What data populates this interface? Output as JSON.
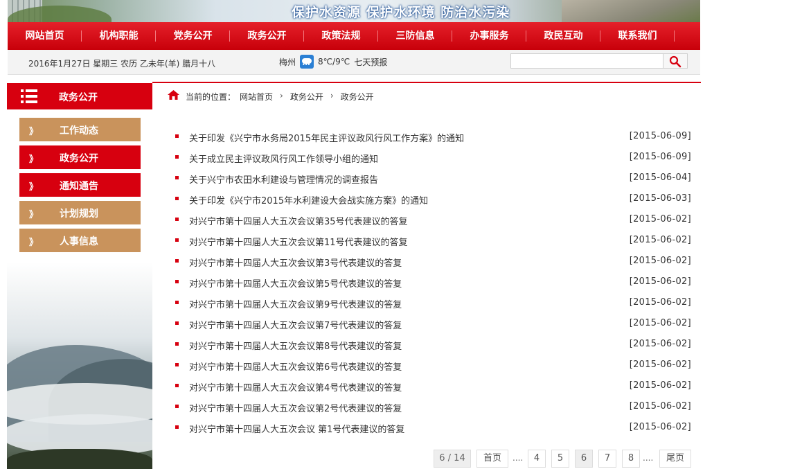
{
  "banner": {
    "slogan": "保护水资源  保护水环境  防治水污染"
  },
  "nav": [
    "网站首页",
    "机构职能",
    "党务公开",
    "政务公开",
    "政策法规",
    "三防信息",
    "办事服务",
    "政民互动",
    "联系我们"
  ],
  "infobar": {
    "date": "2016年1月27日  星期三  农历 乙未年(羊) 腊月十八",
    "city": "梅州",
    "temp": "8℃/9℃",
    "forecast": "七天预报",
    "search_placeholder": ""
  },
  "sidebar": {
    "title": "政务公开",
    "chev": "》",
    "items": [
      {
        "label": "工作动态",
        "color": "#c9935c"
      },
      {
        "label": "政务公开",
        "color": "#d7000f"
      },
      {
        "label": "通知通告",
        "color": "#d7000f"
      },
      {
        "label": "计划规划",
        "color": "#c9935c"
      },
      {
        "label": "人事信息",
        "color": "#c9935c"
      }
    ]
  },
  "breadcrumb": {
    "prefix": "当前的位置：",
    "items": [
      "网站首页",
      "政务公开",
      "政务公开"
    ]
  },
  "articles": [
    {
      "title": "关于印发《兴宁市水务局2015年民主评议政风行风工作方案》的通知",
      "date": "[2015-06-09]"
    },
    {
      "title": "关于成立民主评议政风行风工作领导小组的通知",
      "date": "[2015-06-09]"
    },
    {
      "title": "关于兴宁市农田水利建设与管理情况的调查报告",
      "date": "[2015-06-04]"
    },
    {
      "title": "关于印发《兴宁市2015年水利建设大会战实施方案》的通知",
      "date": "[2015-06-03]"
    },
    {
      "title": "对兴宁市第十四届人大五次会议第35号代表建议的答复",
      "date": "[2015-06-02]"
    },
    {
      "title": "对兴宁市第十四届人大五次会议第11号代表建议的答复",
      "date": "[2015-06-02]"
    },
    {
      "title": "对兴宁市第十四届人大五次会议第3号代表建议的答复",
      "date": "[2015-06-02]"
    },
    {
      "title": "对兴宁市第十四届人大五次会议第5号代表建议的答复",
      "date": "[2015-06-02]"
    },
    {
      "title": "对兴宁市第十四届人大五次会议第9号代表建议的答复",
      "date": "[2015-06-02]"
    },
    {
      "title": "对兴宁市第十四届人大五次会议第7号代表建议的答复",
      "date": "[2015-06-02]"
    },
    {
      "title": "对兴宁市第十四届人大五次会议第8号代表建议的答复",
      "date": "[2015-06-02]"
    },
    {
      "title": "对兴宁市第十四届人大五次会议第6号代表建议的答复",
      "date": "[2015-06-02]"
    },
    {
      "title": "对兴宁市第十四届人大五次会议第4号代表建议的答复",
      "date": "[2015-06-02]"
    },
    {
      "title": "对兴宁市第十四届人大五次会议第2号代表建议的答复",
      "date": "[2015-06-02]"
    },
    {
      "title": "对兴宁市第十四届人大五次会议 第1号代表建议的答复",
      "date": "[2015-06-02]"
    }
  ],
  "pager": {
    "info": "6 / 14",
    "first": "首页",
    "dots": "....",
    "pages": [
      "4",
      "5",
      "6",
      "7",
      "8"
    ],
    "current": "6",
    "last": "尾页"
  },
  "colors": {
    "brand_red": "#d7000f",
    "side_tan": "#c9935c"
  }
}
